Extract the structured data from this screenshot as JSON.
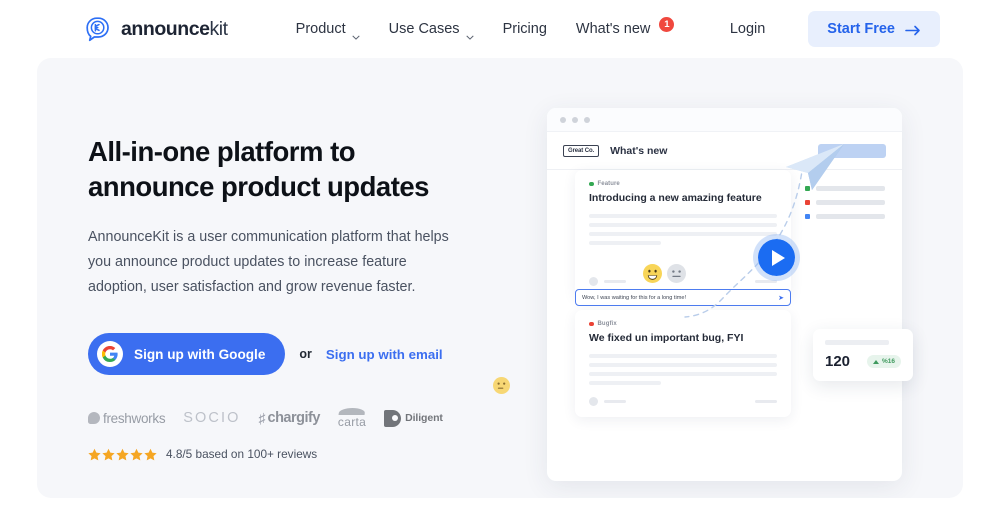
{
  "navbar": {
    "brand": {
      "bold": "announce",
      "light": "kit",
      "icon": "announcekit-logo-icon"
    },
    "links": [
      {
        "label": "Product",
        "has_caret": true
      },
      {
        "label": "Use Cases",
        "has_caret": true
      },
      {
        "label": "Pricing",
        "has_caret": false
      },
      {
        "label": "What's new",
        "has_caret": false,
        "badge": "1"
      }
    ],
    "login_label": "Login",
    "start_free_label": "Start Free"
  },
  "hero": {
    "headline_line1": "All-in-one platform to",
    "headline_line2": "announce product updates",
    "subtext": "AnnounceKit is a user communication platform that helps you announce product updates to increase feature adoption, user satisfaction and grow revenue faster.",
    "google_button_label": "Sign up with Google",
    "or_label": "or",
    "email_link_label": "Sign up with email",
    "client_logos": [
      {
        "name": "freshworks"
      },
      {
        "name": "SOCIO"
      },
      {
        "name": "chargify"
      },
      {
        "name": "carta"
      },
      {
        "name": "Diligent"
      }
    ],
    "rating": {
      "stars": 5,
      "text": "4.8/5 based on 100+ reviews"
    }
  },
  "illustration": {
    "widget": {
      "company_badge": "Great Co.",
      "title": "What's new",
      "posts": [
        {
          "tag": "Feature",
          "tag_color": "#34a853",
          "title": "Introducing a new amazing feature"
        },
        {
          "tag": "Bugfix",
          "tag_color": "#ea4335",
          "title": "We fixed un important bug, FYI"
        }
      ],
      "comment_placeholder": "Wow, I was waiting for this for a long time!",
      "send_icon": "send-icon",
      "side_list_dots": [
        "#34a853",
        "#ea4335",
        "#4285f4"
      ]
    },
    "stats_card": {
      "value": "120",
      "change": "%16"
    },
    "play_button_icon": "play-icon",
    "paper_plane_icon": "paper-plane-icon",
    "float_emoji_icon": "winking-emoji-icon"
  },
  "colors": {
    "brand_blue": "#3b6ef0",
    "cta_bg": "#e8effd",
    "badge_red": "#f0483e",
    "star_orange": "#f5a623",
    "hero_bg": "#f6f7fa",
    "stat_green": "#3f9a5e"
  }
}
